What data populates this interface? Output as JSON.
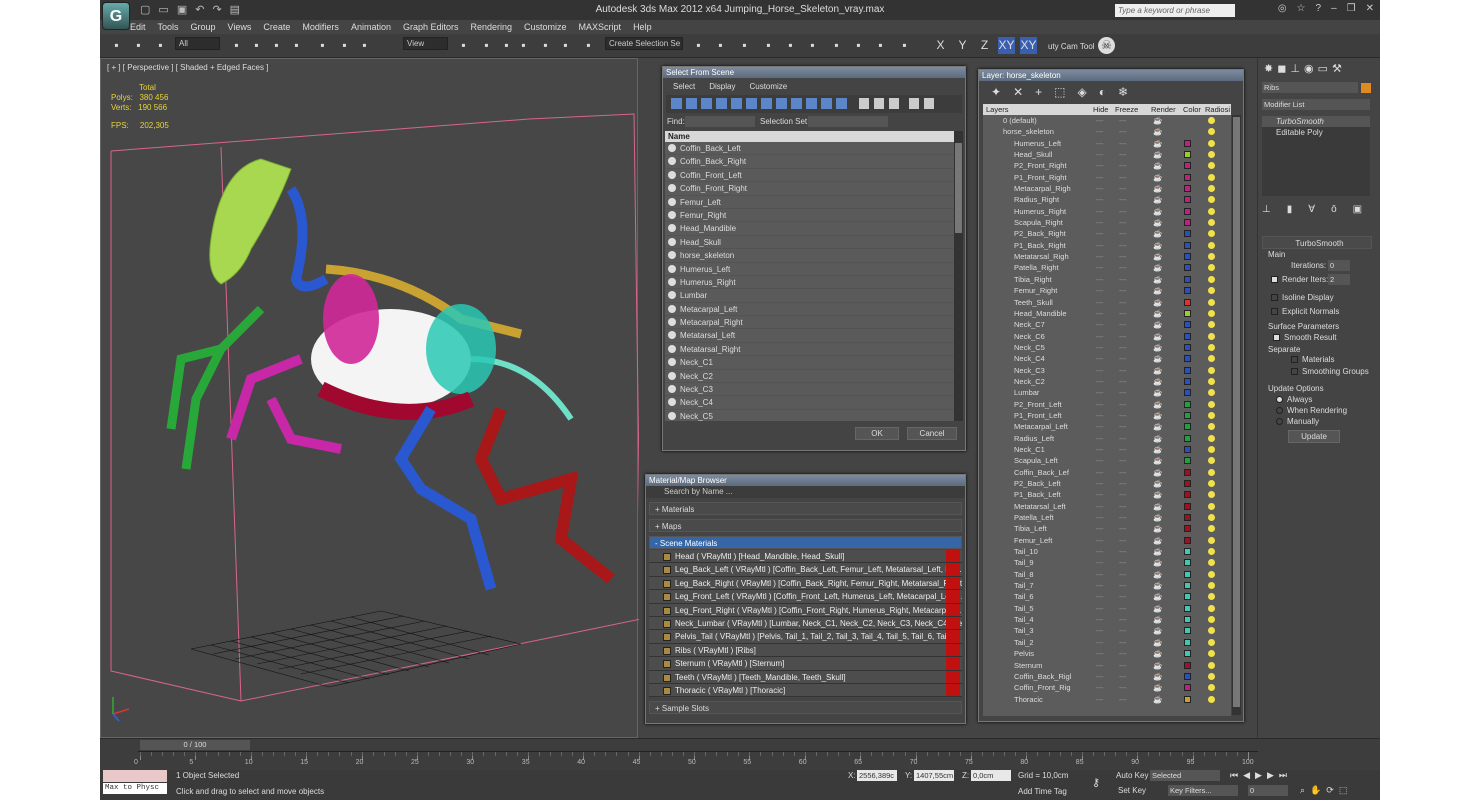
{
  "app": {
    "title": "Autodesk 3ds Max  2012 x64      Jumping_Horse_Skeleton_vray.max",
    "search_placeholder": "Type a keyword or phrase",
    "logo": "3dsmax-logo-icon"
  },
  "menu": [
    "Edit",
    "Tools",
    "Group",
    "Views",
    "Create",
    "Modifiers",
    "Animation",
    "Graph Editors",
    "Rendering",
    "Customize",
    "MAXScript",
    "Help"
  ],
  "toolbar": {
    "filter": "All",
    "ref_coord": "View",
    "selection_set": "Create Selection Se",
    "axis": [
      "X",
      "Y",
      "Z",
      "XY",
      "XY"
    ],
    "tool_label": "uty Cam Tool"
  },
  "viewport": {
    "label": "[ + ] [ Perspective ] [ Shaded + Edged Faces ]",
    "total_label": "Total",
    "polys_label": "Polys:",
    "polys_value": "380 456",
    "verts_label": "Verts:",
    "verts_value": "190 566",
    "fps_label": "FPS:",
    "fps_value": "202,305"
  },
  "select_from_scene": {
    "title": "Select From Scene",
    "menu": [
      "Select",
      "Display",
      "Customize"
    ],
    "find_label": "Find:",
    "selection_set_label": "Selection Set:",
    "column": "Name",
    "items": [
      "Coffin_Back_Left",
      "Coffin_Back_Right",
      "Coffin_Front_Left",
      "Coffin_Front_Right",
      "Femur_Left",
      "Femur_Right",
      "Head_Mandible",
      "Head_Skull",
      "horse_skeleton",
      "Humerus_Left",
      "Humerus_Right",
      "Lumbar",
      "Metacarpal_Left",
      "Metacarpal_Right",
      "Metatarsal_Left",
      "Metatarsal_Right",
      "Neck_C1",
      "Neck_C2",
      "Neck_C3",
      "Neck_C4",
      "Neck_C5"
    ],
    "ok": "OK",
    "cancel": "Cancel"
  },
  "material_browser": {
    "title": "Material/Map Browser",
    "search": "Search by Name ...",
    "rollouts": [
      "+ Materials",
      "+ Maps",
      "- Scene Materials"
    ],
    "materials": [
      "Head  ( VRayMtl ) [Head_Mandible, Head_Skull]",
      "Leg_Back_Left  ( VRayMtl ) [Coffin_Back_Left, Femur_Left, Metatarsal_Left, P1...",
      "Leg_Back_Right  ( VRayMtl ) [Coffin_Back_Right, Femur_Right, Metatarsal_Right...",
      "Leg_Front_Left  ( VRayMtl ) [Coffin_Front_Left, Humerus_Left, Metacarpal_Left, ...",
      "Leg_Front_Right  ( VRayMtl ) [Coffin_Front_Right, Humerus_Right, Metacarpal_...",
      "Neck_Lumbar  ( VRayMtl ) [Lumbar, Neck_C1, Neck_C2, Neck_C3, Neck_C4, Ne...",
      "Pelvis_Tail  ( VRayMtl ) [Pelvis, Tail_1, Tail_2, Tail_3, Tail_4, Tail_5, Tail_6, Tail...",
      "Ribs  ( VRayMtl ) [Ribs]",
      "Sternum  ( VRayMtl ) [Sternum]",
      "Teeth  ( VRayMtl ) [Teeth_Mandible, Teeth_Skull]",
      "Thoracic  ( VRayMtl ) [Thoracic]"
    ],
    "sample_slots": "+ Sample Slots"
  },
  "layer_window": {
    "title": "Layer: horse_skeleton",
    "columns": [
      "Layers",
      "Hide",
      "Freeze",
      "Render",
      "Color",
      "Radiosi"
    ],
    "layers": [
      "0 (default)",
      "horse_skeleton"
    ],
    "objects": [
      [
        "Humerus_Left",
        "#c02080"
      ],
      [
        "Head_Skull",
        "#9acc30"
      ],
      [
        "P2_Front_Right",
        "#c02080"
      ],
      [
        "P1_Front_Right",
        "#c02080"
      ],
      [
        "Metacarpal_Righ",
        "#c02080"
      ],
      [
        "Radius_Right",
        "#c02080"
      ],
      [
        "Humerus_Right",
        "#c02080"
      ],
      [
        "Scapula_Right",
        "#c02080"
      ],
      [
        "P2_Back_Right",
        "#2a50c0"
      ],
      [
        "P1_Back_Right",
        "#2a50c0"
      ],
      [
        "Metatarsal_Righ",
        "#2a50c0"
      ],
      [
        "Patella_Right",
        "#2a50c0"
      ],
      [
        "Tibia_Right",
        "#2a50c0"
      ],
      [
        "Femur_Right",
        "#2a50c0"
      ],
      [
        "Teeth_Skull",
        "#e03030"
      ],
      [
        "Head_Mandible",
        "#9acc30"
      ],
      [
        "Neck_C7",
        "#2a50c0"
      ],
      [
        "Neck_C6",
        "#2a50c0"
      ],
      [
        "Neck_C5",
        "#2a50c0"
      ],
      [
        "Neck_C4",
        "#2a50c0"
      ],
      [
        "Neck_C3",
        "#2a50c0"
      ],
      [
        "Neck_C2",
        "#2a50c0"
      ],
      [
        "Lumbar",
        "#2a50c0"
      ],
      [
        "P2_Front_Left",
        "#20a040"
      ],
      [
        "P1_Front_Left",
        "#20a040"
      ],
      [
        "Metacarpal_Left",
        "#20a040"
      ],
      [
        "Radius_Left",
        "#20a040"
      ],
      [
        "Neck_C1",
        "#2a50c0"
      ],
      [
        "Scapula_Left",
        "#20a040"
      ],
      [
        "Coffin_Back_Lef",
        "#a01020"
      ],
      [
        "P2_Back_Left",
        "#a01020"
      ],
      [
        "P1_Back_Left",
        "#a01020"
      ],
      [
        "Metatarsal_Left",
        "#a01020"
      ],
      [
        "Patella_Left",
        "#a01020"
      ],
      [
        "Tibia_Left",
        "#a01020"
      ],
      [
        "Femur_Left",
        "#a01020"
      ],
      [
        "Tail_10",
        "#40c8b0"
      ],
      [
        "Tail_9",
        "#40c8b0"
      ],
      [
        "Tail_8",
        "#40c8b0"
      ],
      [
        "Tail_7",
        "#40c8b0"
      ],
      [
        "Tail_6",
        "#40c8b0"
      ],
      [
        "Tail_5",
        "#40c8b0"
      ],
      [
        "Tail_4",
        "#40c8b0"
      ],
      [
        "Tail_3",
        "#40c8b0"
      ],
      [
        "Tail_2",
        "#40c8b0"
      ],
      [
        "Pelvis",
        "#40c8b0"
      ],
      [
        "Sternum",
        "#a01030"
      ],
      [
        "Coffin_Back_Rigl",
        "#2a50c0"
      ],
      [
        "Coffin_Front_Rig",
        "#c02080"
      ],
      [
        "Thoracic",
        "#c8a030"
      ]
    ]
  },
  "command_panel": {
    "object_name": "Ribs",
    "modifier_list": "Modifier List",
    "stack": [
      "TurboSmooth",
      "Editable Poly"
    ],
    "rollout": "TurboSmooth",
    "main_label": "Main",
    "iterations_label": "Iterations:",
    "iterations_value": "0",
    "render_iters_label": "Render Iters:",
    "render_iters_value": "2",
    "isoline": "Isoline Display",
    "explicit": "Explicit Normals",
    "surface_params": "Surface Parameters",
    "smooth_result": "Smooth Result",
    "separate": "Separate",
    "materials": "Materials",
    "smoothing_groups": "Smoothing Groups",
    "update_options": "Update Options",
    "always": "Always",
    "when_rendering": "When Rendering",
    "manually": "Manually",
    "update_btn": "Update"
  },
  "timeline": {
    "frame": "0 / 100",
    "ticks": [
      "0",
      "5",
      "10",
      "15",
      "20",
      "25",
      "30",
      "35",
      "40",
      "45",
      "50",
      "55",
      "60",
      "65",
      "70",
      "75",
      "80",
      "85",
      "90",
      "95",
      "100"
    ]
  },
  "status": {
    "maxscript": "Max to Physc",
    "selected": "1 Object Selected",
    "prompt": "Click and drag to select and move objects",
    "x_label": "X:",
    "x_value": "2556,389c",
    "y_label": "Y:",
    "y_value": "1407,55cm",
    "z_label": "Z:",
    "z_value": "0,0cm",
    "grid": "Grid = 10,0cm",
    "add_time_tag": "Add Time Tag",
    "auto_key": "Auto Key",
    "set_key": "Set Key",
    "key_mode": "Selected",
    "key_filters": "Key Filters...",
    "frame_field": "0"
  }
}
